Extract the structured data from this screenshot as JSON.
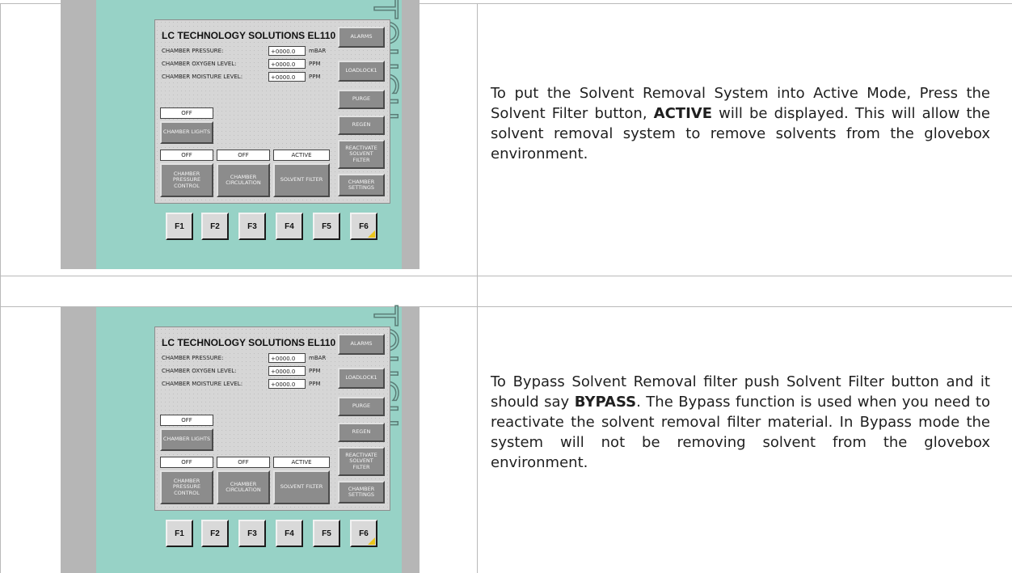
{
  "panel": {
    "title": "LC TECHNOLOGY SOLUTIONS EL110",
    "brand_word": "TOUCH",
    "params": [
      {
        "label": "CHAMBER PRESSURE:",
        "value": "+0000.0",
        "unit": "mBAR"
      },
      {
        "label": "CHAMBER OXYGEN LEVEL:",
        "value": "+0000.0",
        "unit": "PPM"
      },
      {
        "label": "CHAMBER MOISTURE LEVEL:",
        "value": "+0000.0",
        "unit": "PPM"
      }
    ],
    "lights_status": "OFF",
    "lights_button": "CHAMBER LIGHTS",
    "bottom_status": [
      "OFF",
      "OFF",
      "ACTIVE"
    ],
    "bottom_buttons": [
      "CHAMBER PRESSURE CONTROL",
      "CHAMBER CIRCULATION",
      "SOLVENT FILTER"
    ],
    "side_buttons": [
      "ALARMS",
      "LOADLOCK1",
      "PURGE",
      "REGEN",
      "REACTIVATE SOLVENT FILTER",
      "CHAMBER SETTINGS"
    ],
    "function_keys": [
      "F1",
      "F2",
      "F3",
      "F4",
      "F5",
      "F6"
    ]
  },
  "rows": [
    {
      "text_before": "To put the Solvent Removal System into Active Mode, Press the Solvent Filter button, ",
      "emphasis": "ACTIVE",
      "text_after": " will be displayed.  This will allow the solvent removal system to remove solvents from the glovebox environment."
    },
    {
      "text_before": "To Bypass Solvent Removal filter push Solvent Filter button and it should say ",
      "emphasis": "BYPASS",
      "text_after": ". The Bypass function is used when you need to reactivate the solvent removal filter material. In Bypass mode the system will not be removing solvent from the glovebox environment."
    }
  ],
  "colors": {
    "bezel": "#97d2c6",
    "housing": "#b6b6b6",
    "screen_button": "#8c8c8c",
    "f6_corner": "#e8c51a"
  }
}
